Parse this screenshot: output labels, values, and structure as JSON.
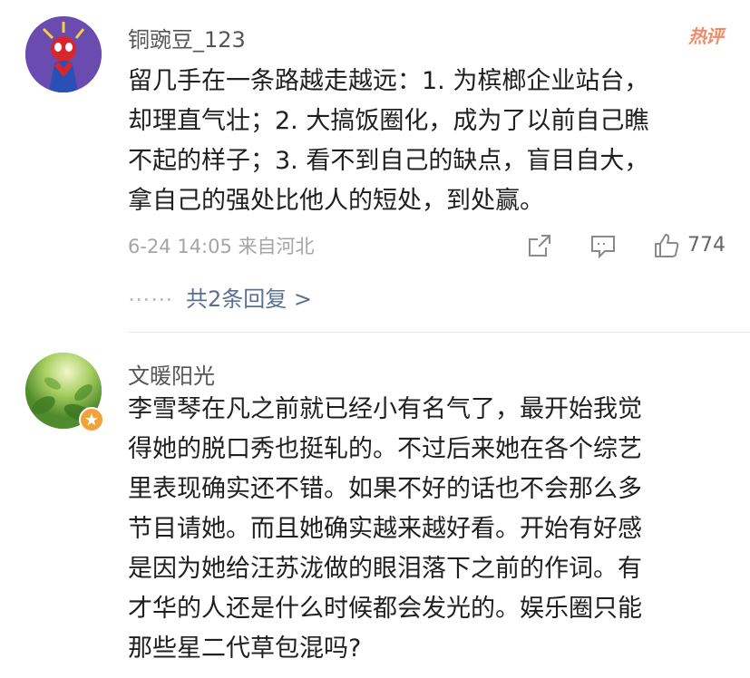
{
  "comments": [
    {
      "username": "铜豌豆_123",
      "badge": "热评",
      "text": "留几手在一条路越走越远：1. 为槟榔企业站台，\n却理直气壮；2. 大搞饭圈化，成为了以前自己瞧\n不起的样子；3. 看不到自己的缺点，盲目自大，\n拿自己的强处比他人的短处，到处赢。",
      "meta": "6-24 14:05  来自河北",
      "like_count": "774",
      "replies_dots": "⋯⋯",
      "replies_label": "共2条回复 >",
      "avatar_icon": "spiderman-avatar"
    },
    {
      "username": "文暖阳光",
      "text": "李雪琴在凡之前就已经小有名气了，最开始我觉\n得她的脱口秀也挺轧的。不过后来她在各个综艺\n里表现确实还不错。如果不好的话也不会那么多\n节目请她。而且她确实越来越好看。开始有好感\n是因为她给汪苏泷做的眼泪落下之前的作词。有\n才华的人还是什么时候都会发光的。娱乐圈只能\n那些星二代草包混吗?",
      "avatar_icon": "leaf-avatar",
      "verified_icon": "star-badge-icon"
    }
  ],
  "icons": {
    "share": "share-icon",
    "reply": "comment-icon",
    "like": "thumbs-up-icon"
  },
  "colors": {
    "link": "#5a6f92",
    "meta": "#a5a5a5",
    "badge": "#f08a6a",
    "username": "#555555"
  }
}
